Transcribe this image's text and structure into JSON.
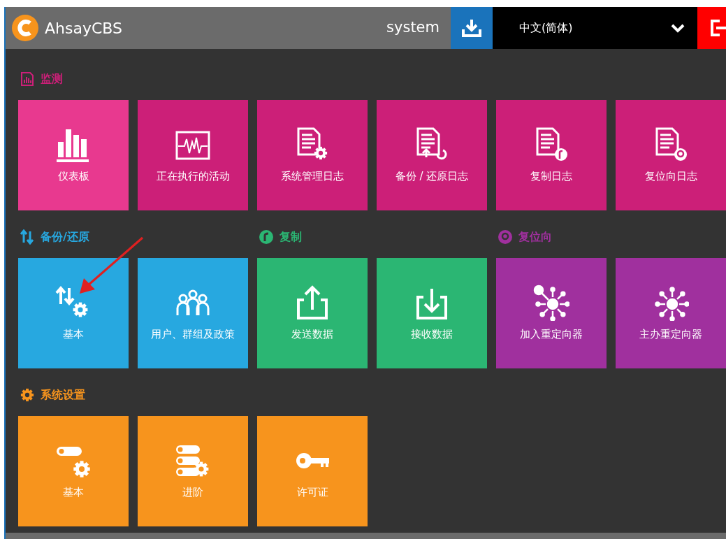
{
  "header": {
    "brand": "AhsayCBS",
    "user": "system",
    "language": "中文(简体)"
  },
  "rows": [
    {
      "sections": [
        {
          "heading": "监测",
          "color": "#cc1f78",
          "tiles": [
            {
              "label": "仪表板",
              "color": "#e8398f"
            },
            {
              "label": "正在执行的活动",
              "color": "#cc1f78"
            },
            {
              "label": "系统管理日志",
              "color": "#cc1f78"
            },
            {
              "label": "备份 / 还原日志",
              "color": "#cc1f78"
            },
            {
              "label": "复制日志",
              "color": "#cc1f78"
            },
            {
              "label": "复位向日志",
              "color": "#cc1f78"
            }
          ]
        }
      ]
    },
    {
      "sections": [
        {
          "heading": "备份/还原",
          "color": "#27a8e0",
          "tiles": [
            {
              "label": "基本",
              "color": "#27a8e0"
            },
            {
              "label": "用户、群组及政策",
              "color": "#27a8e0"
            }
          ]
        },
        {
          "heading": "复制",
          "color": "#2bb673",
          "tiles": [
            {
              "label": "发送数据",
              "color": "#2bb673"
            },
            {
              "label": "接收数据",
              "color": "#2bb673"
            }
          ]
        },
        {
          "heading": "复位向",
          "color": "#a0309e",
          "tiles": [
            {
              "label": "加入重定向器",
              "color": "#a0309e"
            },
            {
              "label": "主办重定向器",
              "color": "#a0309e"
            }
          ]
        }
      ]
    },
    {
      "sections": [
        {
          "heading": "系统设置",
          "color": "#f7941d",
          "tiles": [
            {
              "label": "基本",
              "color": "#f7941d"
            },
            {
              "label": "进阶",
              "color": "#f7941d"
            },
            {
              "label": "许可证",
              "color": "#f7941d"
            }
          ]
        }
      ]
    }
  ]
}
